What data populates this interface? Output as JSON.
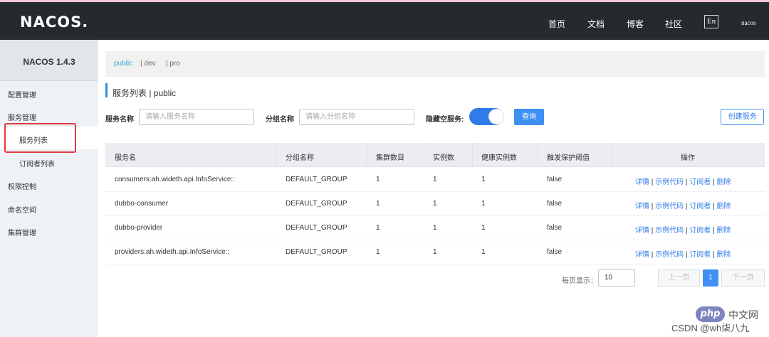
{
  "header": {
    "logo": "NACOS.",
    "nav": [
      "首页",
      "文档",
      "博客",
      "社区"
    ],
    "lang": "En",
    "user": "nacos"
  },
  "sidebar": {
    "version": "NACOS 1.4.3",
    "items": [
      {
        "label": "配置管理"
      },
      {
        "label": "服务管理"
      },
      {
        "label": "服务列表",
        "active": true
      },
      {
        "label": "订阅者列表"
      },
      {
        "label": "权限控制"
      },
      {
        "label": "命名空间"
      },
      {
        "label": "集群管理"
      }
    ]
  },
  "namespaces": [
    "public",
    "| dev",
    "| pro"
  ],
  "page": {
    "title": "服务列表 | public"
  },
  "filters": {
    "service_name_label": "服务名称",
    "service_name_placeholder": "请输入服务名称",
    "group_name_label": "分组名称",
    "group_name_placeholder": "请输入分组名称",
    "hide_empty_label": "隐藏空服务:",
    "hide_empty_on": true,
    "query_label": "查询",
    "create_label": "创建服务"
  },
  "table": {
    "columns": [
      "服务名",
      "分组名称",
      "集群数目",
      "实例数",
      "健康实例数",
      "触发保护阈值",
      "操作"
    ],
    "rows": [
      [
        "consumers:ah.wideth.api.InfoService::",
        "DEFAULT_GROUP",
        "1",
        "1",
        "1",
        "false"
      ],
      [
        "dubbo-consumer",
        "DEFAULT_GROUP",
        "1",
        "1",
        "1",
        "false"
      ],
      [
        "dubbo-provider",
        "DEFAULT_GROUP",
        "1",
        "1",
        "1",
        "false"
      ],
      [
        "providers:ah.wideth.api.InfoService::",
        "DEFAULT_GROUP",
        "1",
        "1",
        "1",
        "false"
      ]
    ],
    "actions": [
      "详情",
      "示例代码",
      "订阅者",
      "删除"
    ]
  },
  "pagination": {
    "page_size_label": "每页显示：",
    "page_size": "10",
    "prev_label": "上一页",
    "current_page": "1",
    "next_label": "下一页"
  },
  "watermark": {
    "php_logo": "php",
    "php_cn": "中文网",
    "csdn": "CSDN @wh柒八九"
  },
  "colors": {
    "header_bg": "#252a2f",
    "sidebar_bg": "#eef1f5",
    "accent": "#2f7be8",
    "highlight": "#e23a3a"
  }
}
